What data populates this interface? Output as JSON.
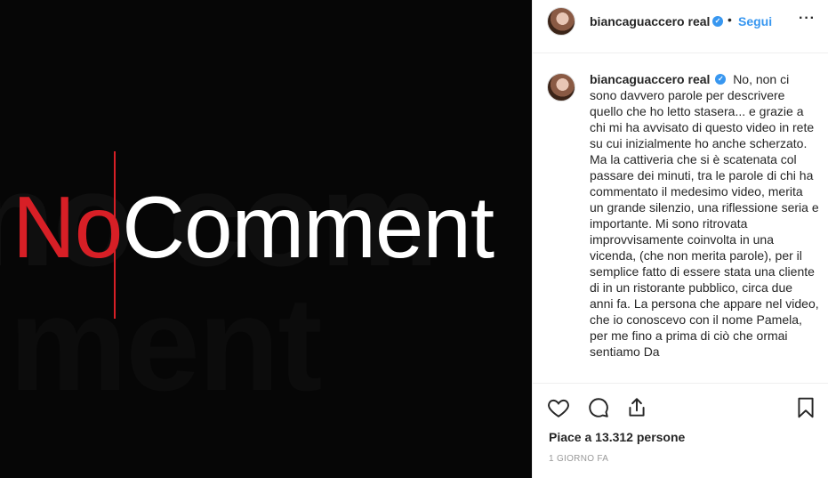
{
  "media": {
    "logo_no": "No",
    "logo_comment": "Comment",
    "ghost_1": "no com",
    "ghost_2": "ment"
  },
  "post": {
    "username": "biancaguaccero real",
    "follow_label": "Segui",
    "follow_separator": "•",
    "more_label": "···",
    "caption_text": "No, non ci sono davvero parole per descrivere quello che ho letto stasera... e grazie a chi mi ha avvisato di questo video in rete su cui inizialmente ho anche scherzato. Ma la cattiveria che si è scatenata col passare dei minuti, tra le parole di chi ha commentato il medesimo video, merita un grande silenzio, una riflessione seria e importante. Mi sono ritrovata improvvisamente coinvolta in una vicenda, (che non merita parole), per il semplice fatto di essere stata una cliente di in un ristorante pubblico, circa due anni fa. La persona che appare nel video, che io conoscevo con il nome Pamela, per me fino a prima di ciò che ormai sentiamo Da",
    "likes_text": "Piace a 13.312 persone",
    "time_text": "1 GIORNO FA"
  },
  "icons": {
    "verified": "verified-badge-icon",
    "like": "heart-icon",
    "comment": "comment-bubble-icon",
    "share": "share-icon",
    "save": "bookmark-icon"
  },
  "colors": {
    "accent": "#3897f0",
    "logo_red": "#d71f26"
  }
}
